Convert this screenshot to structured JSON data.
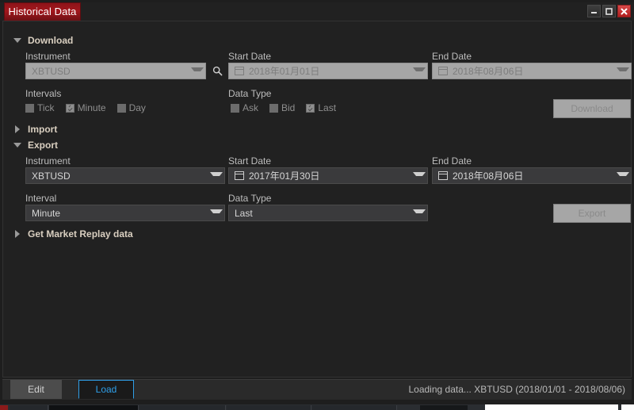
{
  "window": {
    "tab_title": "Historical Data",
    "controls": {
      "minimize": "minimize-button",
      "maximize": "maximize-button",
      "close": "close-button"
    }
  },
  "sections": {
    "download": {
      "title": "Download",
      "expanded": true,
      "instrument": {
        "label": "Instrument",
        "value": "XBTUSD",
        "disabled": true,
        "search_icon": "search-icon"
      },
      "start_date": {
        "label": "Start Date",
        "value": "2018年01月01日",
        "disabled": true
      },
      "end_date": {
        "label": "End Date",
        "value": "2018年08月06日",
        "disabled": true
      },
      "intervals": {
        "label": "Intervals",
        "options": [
          {
            "label": "Tick",
            "checked": false
          },
          {
            "label": "Minute",
            "checked": true
          },
          {
            "label": "Day",
            "checked": false
          }
        ]
      },
      "data_type": {
        "label": "Data Type",
        "options": [
          {
            "label": "Ask",
            "checked": false
          },
          {
            "label": "Bid",
            "checked": false
          },
          {
            "label": "Last",
            "checked": true
          }
        ]
      },
      "action_button": {
        "label": "Download",
        "disabled": true
      }
    },
    "import": {
      "title": "Import",
      "expanded": false
    },
    "export": {
      "title": "Export",
      "expanded": true,
      "instrument": {
        "label": "Instrument",
        "value": "XBTUSD",
        "disabled": false
      },
      "start_date": {
        "label": "Start Date",
        "value": "2017年01月30日",
        "disabled": false
      },
      "end_date": {
        "label": "End Date",
        "value": "2018年08月06日",
        "disabled": false
      },
      "interval": {
        "label": "Interval",
        "value": "Minute",
        "disabled": false
      },
      "data_type": {
        "label": "Data Type",
        "value": "Last",
        "disabled": false
      },
      "action_button": {
        "label": "Export",
        "disabled": true
      }
    },
    "market_replay": {
      "title": "Get Market Replay data",
      "expanded": false
    }
  },
  "footer": {
    "tabs": [
      {
        "label": "Edit",
        "active": false
      },
      {
        "label": "Load",
        "active": true
      }
    ],
    "status": "Loading data... XBTUSD (2018/01/01 - 2018/08/06)"
  },
  "colors": {
    "accent_tab": "#a3171d",
    "active_tab_text": "#2f9fe8",
    "section_title": "#d9cfc0",
    "close_button": "#c82a2a"
  }
}
